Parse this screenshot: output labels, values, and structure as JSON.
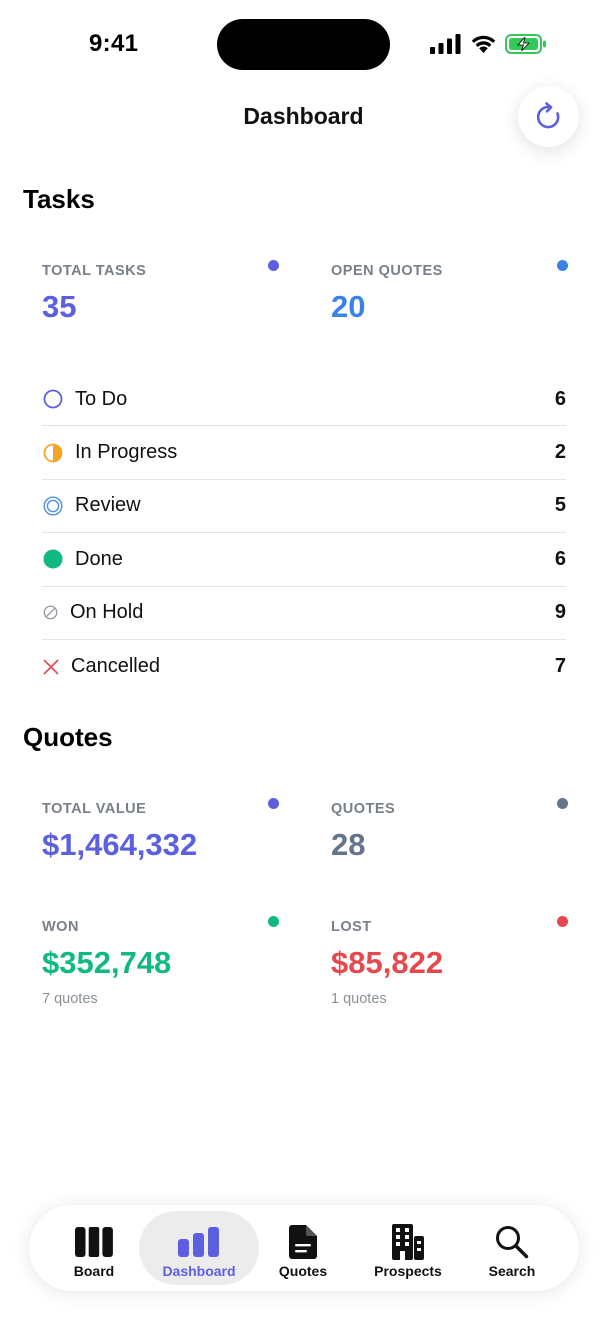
{
  "status_bar": {
    "time": "9:41"
  },
  "header": {
    "title": "Dashboard",
    "refresh_icon": "refresh-icon"
  },
  "tasks": {
    "heading": "Tasks",
    "total_tasks": {
      "label": "TOTAL TASKS",
      "value": "35",
      "color": "#5b5fe0"
    },
    "open_quotes": {
      "label": "OPEN QUOTES",
      "value": "20",
      "color": "#3b82e6"
    },
    "statuses": [
      {
        "label": "To Do",
        "count": "6",
        "icon": "circle-outline-icon",
        "color": "#5b5fe0"
      },
      {
        "label": "In Progress",
        "count": "2",
        "icon": "half-circle-icon",
        "color": "#f5a524"
      },
      {
        "label": "Review",
        "count": "5",
        "icon": "double-circle-icon",
        "color": "#4a90e2"
      },
      {
        "label": "Done",
        "count": "6",
        "icon": "filled-circle-icon",
        "color": "#10b981"
      },
      {
        "label": "On Hold",
        "count": "9",
        "icon": "slashed-circle-icon",
        "color": "#8a9199"
      },
      {
        "label": "Cancelled",
        "count": "7",
        "icon": "x-mark-icon",
        "color": "#e5484d"
      }
    ]
  },
  "quotes": {
    "heading": "Quotes",
    "total_value": {
      "label": "TOTAL VALUE",
      "value": "$1,464,332",
      "color": "#5b5fe0"
    },
    "count": {
      "label": "QUOTES",
      "value": "28",
      "color": "#64748b"
    },
    "won": {
      "label": "WON",
      "value": "$352,748",
      "sub": "7 quotes",
      "color": "#10b981"
    },
    "lost": {
      "label": "LOST",
      "value": "$85,822",
      "sub": "1 quotes",
      "color": "#e5484d"
    }
  },
  "tab_bar": {
    "tabs": [
      {
        "label": "Board",
        "icon": "board-icon",
        "active": false
      },
      {
        "label": "Dashboard",
        "icon": "bar-chart-icon",
        "active": true
      },
      {
        "label": "Quotes",
        "icon": "document-icon",
        "active": false
      },
      {
        "label": "Prospects",
        "icon": "building-icon",
        "active": false
      },
      {
        "label": "Search",
        "icon": "search-icon",
        "active": false
      }
    ]
  }
}
